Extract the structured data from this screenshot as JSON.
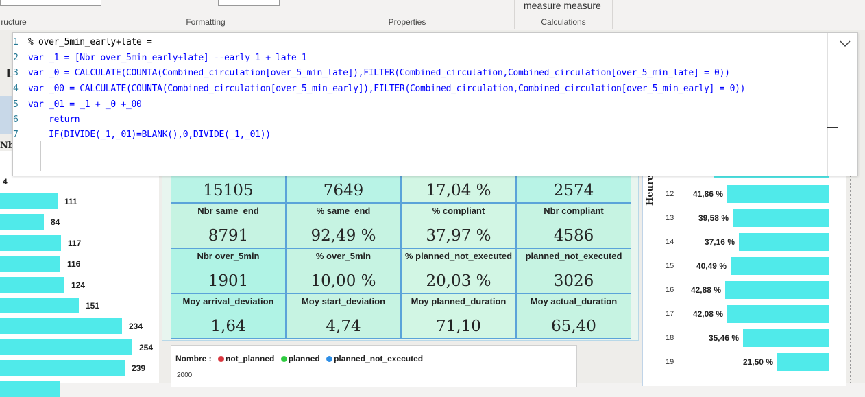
{
  "ribbon": {
    "groups": [
      {
        "label": "ructure"
      },
      {
        "label": "Formatting"
      },
      {
        "label": "Properties"
      },
      {
        "label": "Calculations"
      }
    ],
    "measure_button": "measure measure"
  },
  "left_panel": {
    "letter": "L",
    "axis_label": "Nbr",
    "first_value": "4",
    "bar_values": [
      111,
      84,
      117,
      116,
      124,
      151,
      234,
      254,
      239
    ]
  },
  "editor": {
    "lines": [
      {
        "n": "1",
        "text": "% over_5min_early+late ="
      },
      {
        "n": "2",
        "text": "var _1 = [Nbr over_5min_early+late] --early 1 + late 1"
      },
      {
        "n": "3",
        "text": "var _0 = CALCULATE(COUNTA(Combined_circulation[over_5_min_late]),FILTER(Combined_circulation,Combined_circulation[over_5_min_late] = 0))"
      },
      {
        "n": "4",
        "text": "var _00 = CALCULATE(COUNTA(Combined_circulation[over_5_min_early]),FILTER(Combined_circulation,Combined_circulation[over_5_min_early] = 0))"
      },
      {
        "n": "5",
        "text": "var _01 = _1 + _0 +_00"
      },
      {
        "n": "6",
        "text": "    return"
      },
      {
        "n": "7",
        "text": "    IF(DIVIDE(_1,_01)=BLANK(),0,DIVIDE(_1,_01))"
      }
    ],
    "expand_icon": "chevron-down-icon"
  },
  "kpis": {
    "row0": [
      {
        "value": "15105"
      },
      {
        "value": "7649"
      },
      {
        "value": "17,04 %"
      },
      {
        "value": "2574"
      }
    ],
    "row1": [
      {
        "label": "Nbr same_end",
        "value": "8791"
      },
      {
        "label": "% same_end",
        "value": "92,49 %"
      },
      {
        "label": "% compliant",
        "value": "37,97 %"
      },
      {
        "label": "Nbr compliant",
        "value": "4586"
      }
    ],
    "row2": [
      {
        "label": "Nbr over_5min",
        "value": "1901"
      },
      {
        "label": "% over_5min",
        "value": "10,00 %"
      },
      {
        "label": "% planned_not_executed",
        "value": "20,03 %"
      },
      {
        "label": "planned_not_executed",
        "value": "3026"
      }
    ],
    "row3": [
      {
        "label": "Moy arrival_deviation",
        "value": "1,64"
      },
      {
        "label": "Moy start_deviation",
        "value": "4,74"
      },
      {
        "label": "Moy planned_duration",
        "value": "71,10"
      },
      {
        "label": "Moy actual_duration",
        "value": "65,40"
      }
    ]
  },
  "bottom_chart": {
    "legend_title": "Nombre :",
    "legend": [
      {
        "name": "not_planned",
        "color": "#d9363e"
      },
      {
        "name": "planned",
        "color": "#2ecc40"
      },
      {
        "name": "planned_not_executed",
        "color": "#2f8fe6"
      }
    ],
    "y_tick": "2000"
  },
  "right_chart": {
    "axis_label": "Heure",
    "rows": [
      {
        "hour": "12",
        "pct": "41,86 %",
        "value": 41.86
      },
      {
        "hour": "13",
        "pct": "39,58 %",
        "value": 39.58
      },
      {
        "hour": "14",
        "pct": "37,16 %",
        "value": 37.16
      },
      {
        "hour": "15",
        "pct": "40,49 %",
        "value": 40.49
      },
      {
        "hour": "16",
        "pct": "42,88 %",
        "value": 42.88
      },
      {
        "hour": "17",
        "pct": "42,08 %",
        "value": 42.08
      },
      {
        "hour": "18",
        "pct": "35,46 %",
        "value": 35.46
      },
      {
        "hour": "19",
        "pct": "21,50 %",
        "value": 21.5
      }
    ]
  }
}
